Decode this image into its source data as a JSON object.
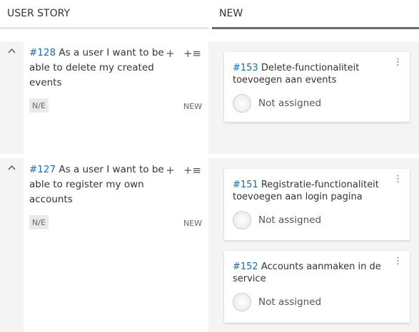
{
  "columns": {
    "user_story": "USER STORY",
    "new": "NEW",
    "collapse_icon": "‹"
  },
  "stories": [
    {
      "id": "#128",
      "title": "As a user I want to be able to delete my created events",
      "badge": "N/E",
      "state": "NEW",
      "cards": [
        {
          "id": "#153",
          "title": "Delete-functionaliteit toevoegen aan events",
          "assignee": "Not assigned"
        }
      ]
    },
    {
      "id": "#127",
      "title": "As a user I want to be able to register my own accounts",
      "badge": "N/E",
      "state": "NEW",
      "cards": [
        {
          "id": "#151",
          "title": "Registratie-functionaliteit toevoegen aan login pagina",
          "assignee": "Not assigned"
        },
        {
          "id": "#152",
          "title": "Accounts aanmaken in de service",
          "assignee": "Not assigned"
        }
      ]
    }
  ],
  "icons": {
    "chevron_up": "⌃",
    "add": "+",
    "add_task": "+≡",
    "kebab": "⋮"
  },
  "colors": {
    "link": "#106ebe",
    "header_active_border": "#666a73"
  }
}
